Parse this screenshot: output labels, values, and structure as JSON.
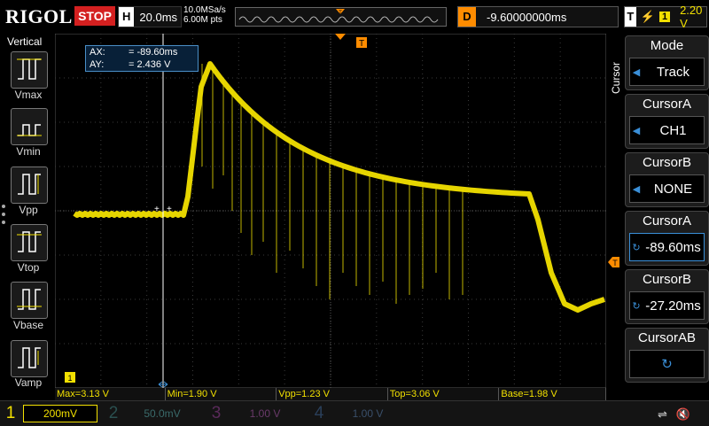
{
  "brand": "RIGOL",
  "run_state": "STOP",
  "horizontal": {
    "label": "H",
    "timebase": "20.0ms",
    "sample_rate": "10.0MSa/s",
    "points": "6.00M pts"
  },
  "delay": {
    "label": "D",
    "value": "-9.60000000ms"
  },
  "trigger": {
    "label": "T",
    "source": "1",
    "level": "2.20 V"
  },
  "left_panel": {
    "title": "Vertical",
    "items": [
      "Vmax",
      "Vmin",
      "Vpp",
      "Vtop",
      "Vbase",
      "Vamp"
    ]
  },
  "cursor_readout": {
    "ax_label": "AX:",
    "ax_value": "= -89.60ms",
    "ay_label": "AY:",
    "ay_value": "= 2.436 V"
  },
  "right_menu": {
    "side_title": "Cursor",
    "items": [
      {
        "title": "Mode",
        "value": "Track"
      },
      {
        "title": "CursorA",
        "value": "CH1"
      },
      {
        "title": "CursorB",
        "value": "NONE"
      },
      {
        "title": "CursorA",
        "value": "-89.60ms"
      },
      {
        "title": "CursorB",
        "value": "-27.20ms"
      },
      {
        "title": "CursorAB",
        "value": ""
      }
    ]
  },
  "measurements": [
    "Max=3.13 V",
    "Min=1.90 V",
    "Vpp=1.23 V",
    "Top=3.06 V",
    "Base=1.98 V"
  ],
  "channels": [
    {
      "num": "1",
      "scale": "200mV",
      "color": "#f2e000"
    },
    {
      "num": "2",
      "scale": "50.0mV",
      "color": "#00c8c8"
    },
    {
      "num": "3",
      "scale": "1.00 V",
      "color": "#d040d0"
    },
    {
      "num": "4",
      "scale": "1.00 V",
      "color": "#3a8fd8"
    }
  ],
  "colors": {
    "ch1": "#f2e000",
    "accent": "#3a8fd8",
    "stop": "#d42020",
    "marker": "#ff8c00"
  }
}
